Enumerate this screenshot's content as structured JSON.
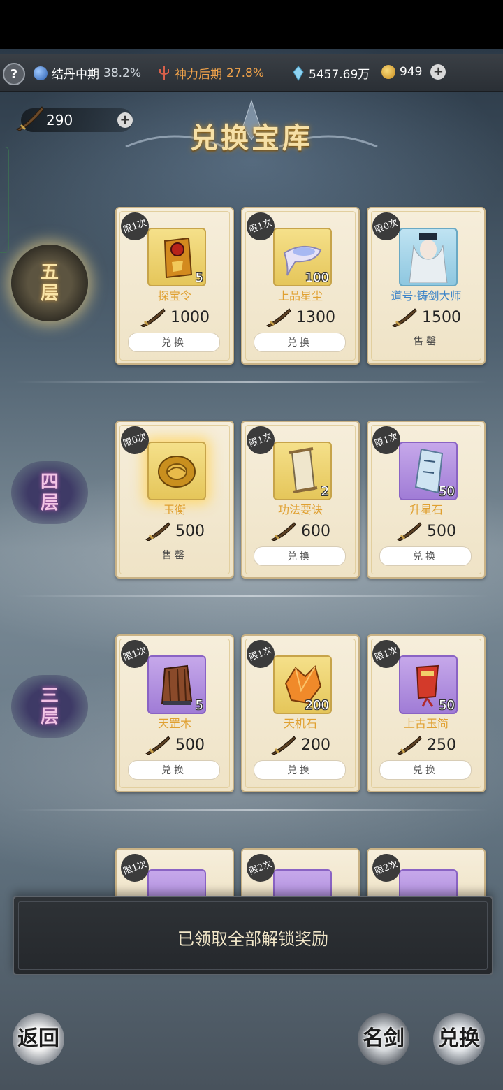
{
  "topbar": {
    "help_icon": "?",
    "realm1": {
      "label": "结丹中期",
      "pct": "38.2%"
    },
    "realm2": {
      "label": "神力后期",
      "pct": "27.8%"
    },
    "crystal": "5457.69万",
    "coin": "949"
  },
  "sword_currency": {
    "amount": "290"
  },
  "title": "兑换宝库",
  "floors": [
    {
      "label": "五层"
    },
    {
      "label": "四层"
    },
    {
      "label": "三层"
    }
  ],
  "items": [
    {
      "limit": "限1次",
      "name": "探宝令",
      "qty": "5",
      "price": "1000",
      "action": "兑换"
    },
    {
      "limit": "限1次",
      "name": "上品星尘",
      "qty": "100",
      "price": "1300",
      "action": "兑换"
    },
    {
      "limit": "限0次",
      "name": "道号·铸剑大师",
      "qty": "",
      "price": "1500",
      "action": "售罄"
    },
    {
      "limit": "限0次",
      "name": "玉衡",
      "qty": "",
      "price": "500",
      "action": "售罄"
    },
    {
      "limit": "限1次",
      "name": "功法要诀",
      "qty": "2",
      "price": "600",
      "action": "兑换"
    },
    {
      "limit": "限1次",
      "name": "升星石",
      "qty": "50",
      "price": "500",
      "action": "兑换"
    },
    {
      "limit": "限1次",
      "name": "天罡木",
      "qty": "5",
      "price": "500",
      "action": "兑换"
    },
    {
      "limit": "限1次",
      "name": "天机石",
      "qty": "200",
      "price": "200",
      "action": "兑换"
    },
    {
      "limit": "限1次",
      "name": "上古玉简",
      "qty": "50",
      "price": "250",
      "action": "兑换"
    },
    {
      "limit": "限1次"
    },
    {
      "limit": "限2次"
    },
    {
      "limit": "限2次"
    }
  ],
  "bottom_message": "已领取全部解锁奖励",
  "buttons": {
    "back": "返回",
    "famous_sword": "名剑",
    "exchange": "兑换"
  },
  "colors": {
    "gold_text": "#e0a030",
    "blue_text": "#3b83c8",
    "card_bg": "#f6eedb"
  }
}
